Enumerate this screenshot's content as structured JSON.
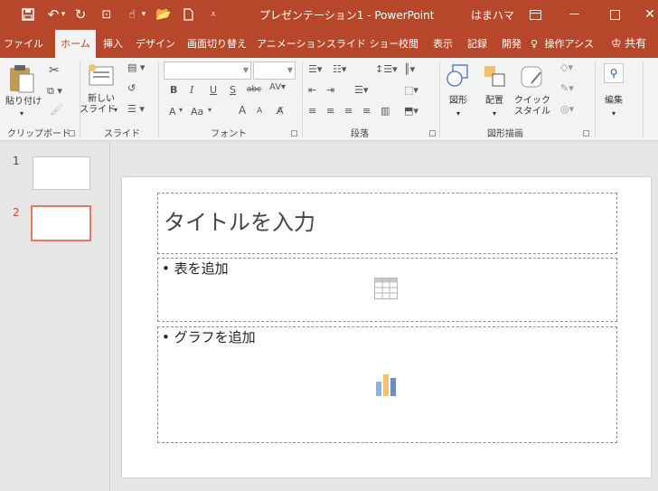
{
  "titlebar": {
    "title": "プレゼンテーション1  -  PowerPoint",
    "user": "はまハマ",
    "icons": [
      "save-icon",
      "undo-icon",
      "redo-icon",
      "present-from-start-icon",
      "touch-mode-icon",
      "open-icon",
      "new-icon",
      "customize-qat-icon",
      "ribbon-display-options-icon",
      "minimize-icon",
      "maximize-icon",
      "close-icon"
    ]
  },
  "tabs": [
    "ファイル",
    "ホーム",
    "挿入",
    "デザイン",
    "画面切り替え",
    "アニメーション",
    "スライド ショー",
    "校閲",
    "表示",
    "記録",
    "開発"
  ],
  "tell_me": "操作アシス",
  "share": "共有",
  "ribbon": {
    "paste": "貼り付け",
    "new_slide_1": "新しい",
    "new_slide_2": "スライド",
    "shapes": "図形",
    "arrange": "配置",
    "quick_styles_1": "クイック",
    "quick_styles_2": "スタイル",
    "editing": "編集",
    "groups": {
      "clipboard": "クリップボード",
      "slides": "スライド",
      "font": "フォント",
      "paragraph": "段落",
      "drawing": "図形描画"
    },
    "font_buttons": {
      "bold": "B",
      "italic": "I",
      "underline": "U",
      "shadow": "S",
      "strike": "abc",
      "grow": "A",
      "shrink": "A",
      "font_color": "A",
      "case": "Aa"
    }
  },
  "slides_pane": {
    "thumbs": [
      {
        "number": "1",
        "active": false
      },
      {
        "number": "2",
        "active": true
      }
    ]
  },
  "slide": {
    "title_placeholder": "タイトルを入力",
    "content1": "• 表を追加",
    "content2": "• グラフを追加"
  },
  "colors": {
    "accent": "#b7472a",
    "active_thumb": "#e9795c",
    "chart_bars": [
      "#8fb4d9",
      "#f2c36b",
      "#6a8fbf"
    ]
  }
}
